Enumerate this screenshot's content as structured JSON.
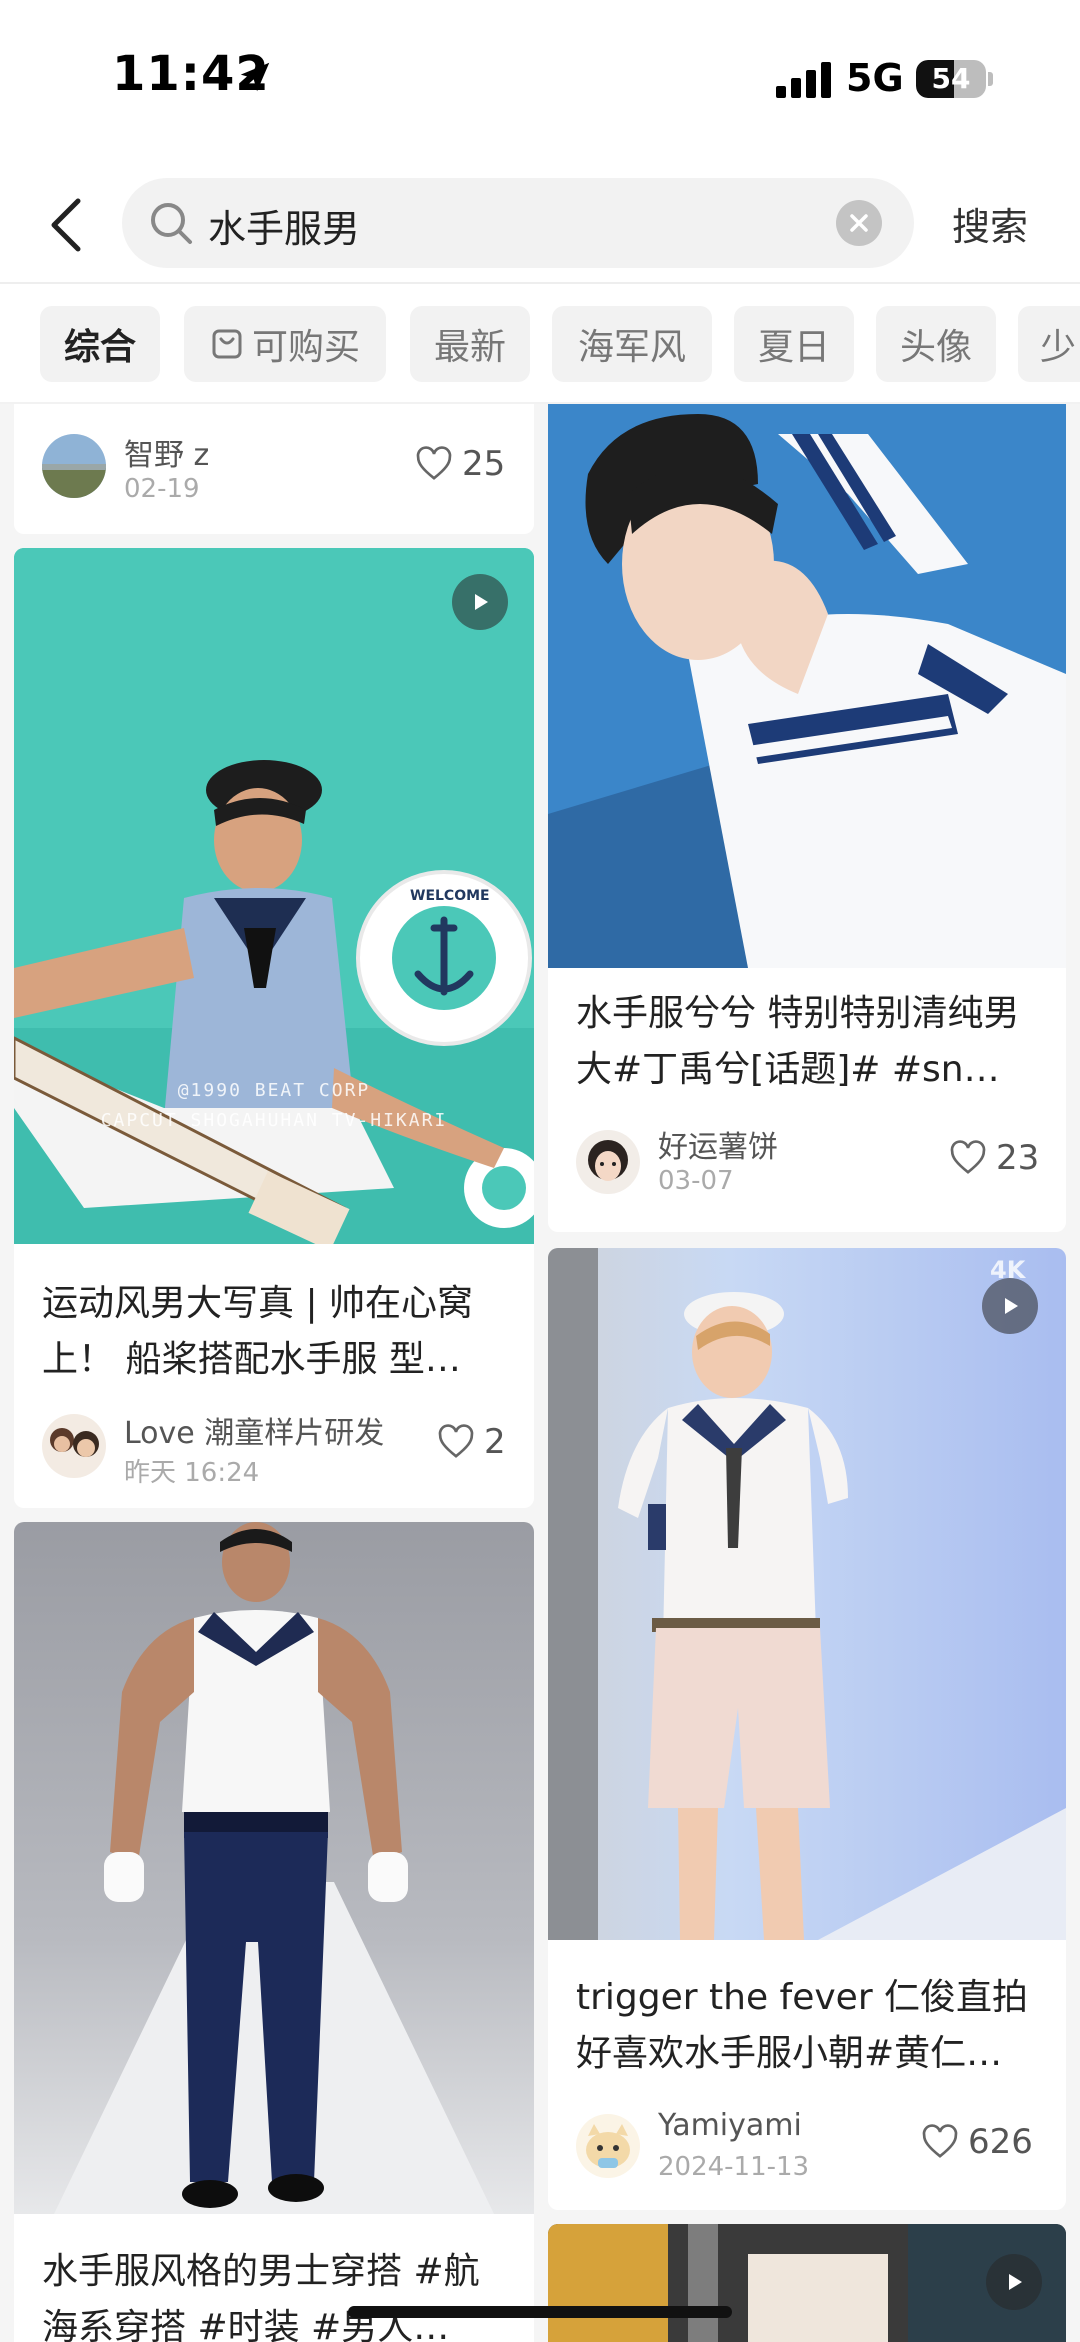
{
  "status": {
    "time": "11:42",
    "network": "5G",
    "battery": "54",
    "battery_level": 0.54
  },
  "search": {
    "query": "水手服男",
    "submit_label": "搜索"
  },
  "filters": [
    "综合",
    "可购买",
    "最新",
    "海军风",
    "夏日",
    "头像",
    "少"
  ],
  "colors": {
    "accent_text": "#222222",
    "muted_text": "#aaaaaa"
  },
  "feed": {
    "card0": {
      "author": "智野 z",
      "date": "02-19",
      "likes": "25"
    },
    "card1": {
      "image_text_1": "@1990 BEAT CORP",
      "image_text_2": "CAPCUT SHOGAHUHAN TV-HIKARI",
      "image_text_3": "WELCOME",
      "title": "运动风男大写真 | 帅在心窝上！ 船桨搭配水手服 型…",
      "author": "Love 潮童样片研发",
      "date": "昨天 16:24",
      "likes": "2"
    },
    "card2": {
      "title": "水手服风格的男士穿搭 #航海系穿搭 #时装 #男人…"
    },
    "card3": {
      "title": "水手服兮兮 特别特别清纯男大#丁禹兮[话题]# #sn…",
      "author": "好运薯饼",
      "date": "03-07",
      "likes": "23"
    },
    "card4": {
      "badge": "4K",
      "title": "trigger the fever 仁俊直拍好喜欢水手服小朝#黄仁…",
      "author": "Yamiyami",
      "date": "2024-11-13",
      "likes": "626"
    }
  }
}
